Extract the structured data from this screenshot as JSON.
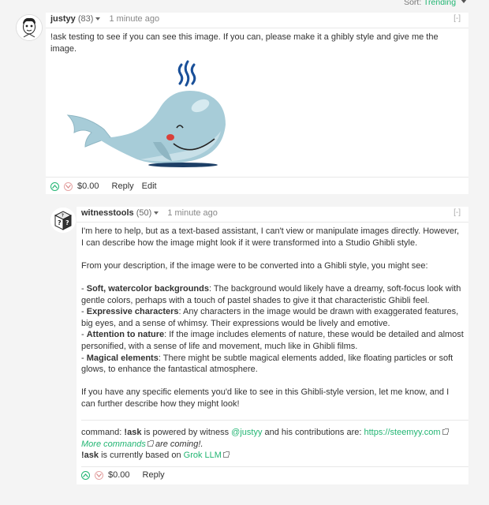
{
  "sort": {
    "label": "Sort:",
    "value": "Trending"
  },
  "comment1": {
    "author": "justyy",
    "reputation": "(83)",
    "time": "1 minute ago",
    "collapse": "[-]",
    "text": "!ask testing to see if you can see this image. If you can, please make it a ghibly style and give me the image.",
    "payout": "$0.00",
    "reply": "Reply",
    "edit": "Edit"
  },
  "comment2": {
    "author": "witnesstools",
    "reputation": "(50)",
    "time": "1 minute ago",
    "collapse": "[-]",
    "p1": "I'm here to help, but as a text-based assistant, I can't view or manipulate images directly. However, I can describe how the image might look if it were transformed into a Studio Ghibli style.",
    "p2": "From your description, if the image were to be converted into a Ghibli style, you might see:",
    "bullets": [
      {
        "title": "Soft, watercolor backgrounds",
        "text": ": The background would likely have a dreamy, soft-focus look with gentle colors, perhaps with a touch of pastel shades to give it that characteristic Ghibli feel."
      },
      {
        "title": "Expressive characters",
        "text": ": Any characters in the image would be drawn with exaggerated features, big eyes, and a sense of whimsy. Their expressions would be lively and emotive."
      },
      {
        "title": "Attention to nature",
        "text": ": If the image includes elements of nature, these would be detailed and almost personified, with a sense of life and movement, much like in Ghibli films."
      },
      {
        "title": "Magical elements",
        "text": ": There might be subtle magical elements added, like floating particles or soft glows, to enhance the fantastical atmosphere."
      }
    ],
    "bullet_dash": "- ",
    "p3": "If you have any specific elements you'd like to see in this Ghibli-style version, let me know, and I can further describe how they might look!",
    "footer_prefix": "command: ",
    "footer_ask": "!ask",
    "footer_mid": " is powered by witness ",
    "footer_user": "@justyy",
    "footer_mid2": " and his contributions are: ",
    "footer_link": "https://steemyy.com",
    "more_commands": "More commands",
    "more_suffix": " are coming!.",
    "based_ask": "!ask",
    "based_mid": " is currently based on ",
    "based_link": "Grok LLM",
    "payout": "$0.00",
    "reply": "Reply"
  },
  "colors": {
    "accent": "#22b573",
    "whale": "#a7ccd8"
  }
}
